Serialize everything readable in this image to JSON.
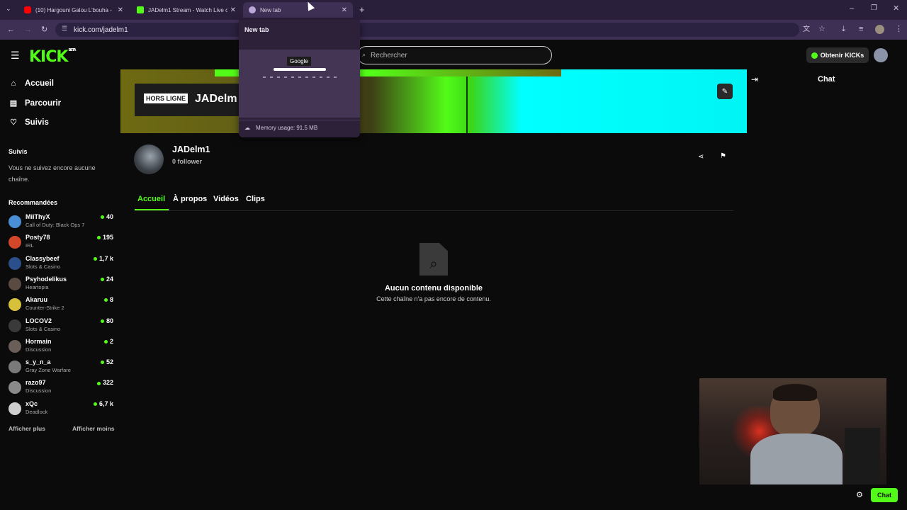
{
  "browser": {
    "tabs": [
      {
        "title": "(10) Hargouni Galou L'bouha -",
        "favicon_color": "#ff0000"
      },
      {
        "title": "JADelm1 Stream - Watch Live o",
        "favicon_color": "#53fc18"
      },
      {
        "title": "New tab",
        "favicon_color": "#bba6d6"
      }
    ],
    "address": "kick.com/jadelm1",
    "tab_preview": {
      "title": "New tab",
      "memory": "Memory usage: 91.5 MB",
      "google_text": "Google"
    }
  },
  "site": {
    "logo": "KICK",
    "logo_badge": "BETA",
    "search_placeholder": "Rechercher",
    "get_kicks_label": "Obtenir KICKs",
    "nav": [
      {
        "label": "Accueil",
        "icon": "home-icon"
      },
      {
        "label": "Parcourir",
        "icon": "browse-icon"
      },
      {
        "label": "Suivis",
        "icon": "heart-icon"
      }
    ],
    "followed_heading": "Suivis",
    "followed_empty": "Vous ne suivez encore aucune chaîne.",
    "recommended_heading": "Recommandées",
    "recommended": [
      {
        "name": "MiiThyX",
        "category": "Call of Duty: Black Ops 7",
        "viewers": "40",
        "avatar_color": "#4a8fd6"
      },
      {
        "name": "Posty78",
        "category": "IRL",
        "viewers": "195",
        "avatar_color": "#d2472a"
      },
      {
        "name": "Classybeef",
        "category": "Slots & Casino",
        "viewers": "1,7 k",
        "avatar_color": "#2a4f8a"
      },
      {
        "name": "Psyhodelikus",
        "category": "Heartopia",
        "viewers": "24",
        "avatar_color": "#5a4a42"
      },
      {
        "name": "Akaruu",
        "category": "Counter-Strike 2",
        "viewers": "8",
        "avatar_color": "#d8c13a"
      },
      {
        "name": "LOCOV2",
        "category": "Slots & Casino",
        "viewers": "80",
        "avatar_color": "#3a3a3a"
      },
      {
        "name": "Hormain",
        "category": "Discussion",
        "viewers": "2",
        "avatar_color": "#6a5e58"
      },
      {
        "name": "s_y_n_a",
        "category": "Gray Zone Warfare",
        "viewers": "52",
        "avatar_color": "#7a7a7a"
      },
      {
        "name": "razo97",
        "category": "Discussion",
        "viewers": "322",
        "avatar_color": "#8a8a8a"
      },
      {
        "name": "xQc",
        "category": "Deadlock",
        "viewers": "6,7 k",
        "avatar_color": "#cfcfcf"
      }
    ],
    "show_more": "Afficher plus",
    "show_less": "Afficher moins",
    "banner": {
      "offline_label": "HORS LIGNE",
      "channel_overlay": "JADelm"
    },
    "channel": {
      "name": "JADelm1",
      "followers": "0 follower"
    },
    "channel_tabs": [
      "Accueil",
      "À propos",
      "Vidéos",
      "Clips"
    ],
    "empty_title": "Aucun contenu disponible",
    "empty_sub": "Cette chaîne n'a pas encore de contenu.",
    "chat_title": "Chat",
    "chat_button": "Chat"
  }
}
